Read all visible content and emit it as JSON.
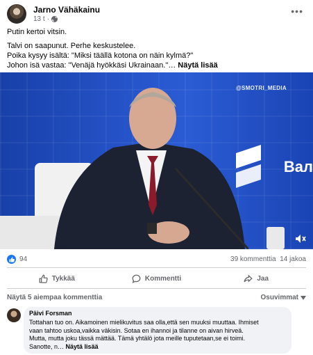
{
  "post": {
    "author": "Jarno Vähäkainu",
    "time": "13 t",
    "more_icon": "more-horizontal-icon",
    "lines": [
      "Putin kertoi vitsin.",
      "Talvi on saapunut. Perhe keskustelee.",
      "Poika kysyy isältä: \"Miksi täällä kotona on näin kylmä?\"",
      "Johon isä vastaa: \"Venäjä hyökkäsi Ukrainaan.\"… "
    ],
    "see_more": "Näytä lisää"
  },
  "video": {
    "watermark": "@SMOTRI_MEDIA",
    "background_text": "Вал",
    "mute_icon": "volume-muted-icon"
  },
  "stats": {
    "like_count": "94",
    "comments": "39 kommenttia",
    "shares": "14 jakoa"
  },
  "actions": {
    "like": "Tykkää",
    "comment": "Kommentti",
    "share": "Jaa"
  },
  "comments": {
    "previous": "Näytä 5 aiempaa kommenttia",
    "sort_label": "Osuvimmat",
    "items": [
      {
        "author": "Päivi Forsman",
        "lines": [
          "Tottahan tuo on. Aikamoinen mielikuvitus saa olla,että sen muuksi muuttaa. Ihmiset",
          "vaan tahtoo uskoa,vaikka väkisin. Sotaa en ihannoi ja tilanne on aivan hirveä.",
          "Mutta, mutta joku tässä mättää. Tämä yhtälö jota meille tuputetaan,se ei toimi.",
          "Sanotte, n… "
        ],
        "see_more": "Näytä lisää"
      }
    ]
  },
  "colors": {
    "accent": "#1877f2",
    "muted": "#65676b",
    "bubble": "#f0f2f5"
  }
}
